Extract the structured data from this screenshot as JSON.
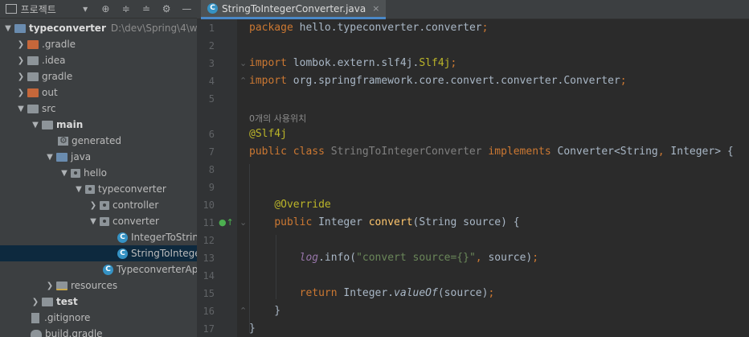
{
  "project_panel": {
    "title": "프로젝트",
    "toolbar_icons": [
      "chevron-down-icon",
      "locate-icon",
      "expand-all-icon",
      "collapse-all-icon",
      "gear-icon",
      "minimize-icon"
    ],
    "tree": [
      {
        "label": "typeconverter",
        "hint": "D:\\dev\\Spring\\4\\w",
        "icon": "module-folder",
        "bold": true,
        "expanded": true
      },
      {
        "label": ".gradle",
        "icon": "folder-excluded",
        "expanded": false
      },
      {
        "label": ".idea",
        "icon": "folder",
        "expanded": false
      },
      {
        "label": "gradle",
        "icon": "folder",
        "expanded": false
      },
      {
        "label": "out",
        "icon": "folder-excluded",
        "expanded": false
      },
      {
        "label": "src",
        "icon": "folder",
        "expanded": true
      },
      {
        "label": "main",
        "icon": "folder",
        "bold": true,
        "expanded": true
      },
      {
        "label": "generated",
        "icon": "generated-folder"
      },
      {
        "label": "java",
        "icon": "source-folder",
        "expanded": true
      },
      {
        "label": "hello",
        "icon": "package",
        "expanded": true
      },
      {
        "label": "typeconverter",
        "icon": "package",
        "expanded": true
      },
      {
        "label": "controller",
        "icon": "package",
        "expanded": false
      },
      {
        "label": "converter",
        "icon": "package",
        "expanded": true
      },
      {
        "label": "IntegerToString",
        "icon": "class"
      },
      {
        "label": "StringToInteger",
        "icon": "class",
        "selected": true
      },
      {
        "label": "TypeconverterApp",
        "icon": "class"
      },
      {
        "label": "resources",
        "icon": "resources-folder",
        "expanded": false
      },
      {
        "label": "test",
        "icon": "folder",
        "bold": true,
        "expanded": false
      },
      {
        "label": ".gitignore",
        "icon": "file"
      },
      {
        "label": "build.gradle",
        "icon": "gradle-file"
      }
    ]
  },
  "editor": {
    "tab": {
      "label": "StringToIntegerConverter.java",
      "icon": "class-icon",
      "close": "×"
    },
    "usages_hint": "0개의 사용위치",
    "lines": [
      "1",
      "2",
      "3",
      "4",
      "5",
      "6",
      "7",
      "8",
      "9",
      "10",
      "11",
      "12",
      "13",
      "14",
      "15",
      "16",
      "17"
    ]
  }
}
